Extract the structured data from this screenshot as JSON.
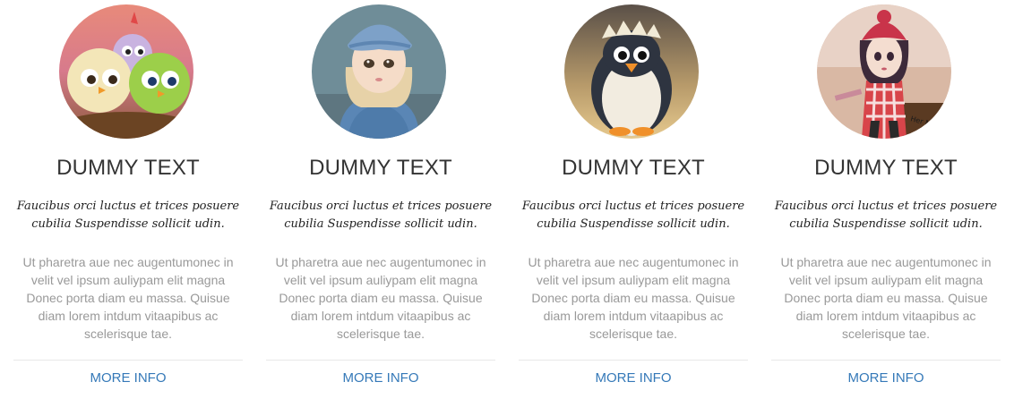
{
  "cards": [
    {
      "image": "fuzzy-birds-image",
      "title": "DUMMY TEXT",
      "tagline": "Faucibus orci luctus et trices posuere cubilia Suspendisse sollicit udin.",
      "description": "Ut pharetra aue nec augentumonec  in velit vel ipsum auliypam elit magna Donec porta diam eu massa. Quisue diam lorem intdum vitaapibus  ac scelerisque tae.",
      "link": "MORE INFO"
    },
    {
      "image": "knit-hat-doll-image",
      "title": "DUMMY TEXT",
      "tagline": "Faucibus orci luctus et trices posuere cubilia Suspendisse sollicit udin.",
      "description": "Ut pharetra aue nec augentumonec  in velit vel ipsum auliypam elit magna Donec porta diam eu massa. Quisue diam lorem intdum vitaapibus  ac scelerisque tae.",
      "link": "MORE INFO"
    },
    {
      "image": "penguin-eggshell-image",
      "title": "DUMMY TEXT",
      "tagline": "Faucibus orci luctus et trices posuere cubilia Suspendisse sollicit udin.",
      "description": "Ut pharetra aue nec augentumonec  in velit vel ipsum auliypam elit magna Donec porta diam eu massa. Quisue diam lorem intdum vitaapibus  ac scelerisque tae.",
      "link": "MORE INFO"
    },
    {
      "image": "red-hat-doll-image",
      "title": "DUMMY TEXT",
      "tagline": "Faucibus orci luctus et trices posuere cubilia Suspendisse sollicit udin.",
      "description": "Ut pharetra aue nec augentumonec  in velit vel ipsum auliypam elit magna Donec porta diam eu massa. Quisue diam lorem intdum vitaapibus  ac scelerisque tae.",
      "link": "MORE INFO"
    }
  ],
  "colors": {
    "title": "#333333",
    "tagline": "#222222",
    "description": "#999999",
    "link": "#3579b8",
    "divider": "#e8e8e8"
  }
}
